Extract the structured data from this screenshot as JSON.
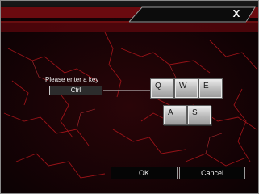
{
  "window": {
    "close_label": "X"
  },
  "dialog": {
    "prompt": "Please enter a key",
    "key_value": "Ctrl",
    "keys": [
      "Q",
      "W",
      "E",
      "A",
      "S"
    ],
    "ok_label": "OK",
    "cancel_label": "Cancel"
  },
  "colors": {
    "accent": "#c41a1c",
    "background": "#0a0103",
    "key_face": "#c8c8c8"
  }
}
